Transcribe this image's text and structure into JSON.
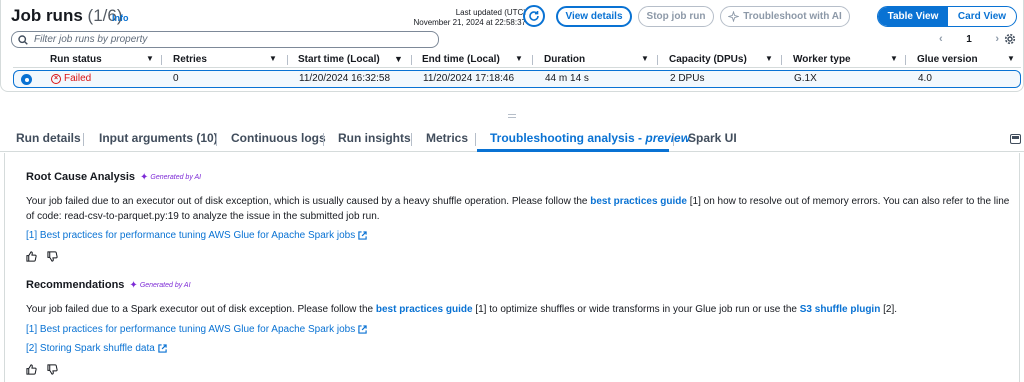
{
  "header": {
    "title": "Job runs",
    "count": "(1/6)",
    "info": "Info",
    "last_updated_label": "Last updated (UTC)",
    "last_updated_value": "November 21, 2024 at 22:58:37",
    "view_details": "View details",
    "stop_job_run": "Stop job run",
    "troubleshoot_ai": "Troubleshoot with AI",
    "table_view": "Table View",
    "card_view": "Card View"
  },
  "search": {
    "placeholder": "Filter job runs by property"
  },
  "pagination": {
    "page": "1",
    "prev": "‹",
    "next": "›"
  },
  "table": {
    "columns": [
      "Run status",
      "Retries",
      "Start time (Local)",
      "End time (Local)",
      "Duration",
      "Capacity (DPUs)",
      "Worker type",
      "Glue version"
    ],
    "row": {
      "status": "Failed",
      "retries": "0",
      "start_time": "11/20/2024 16:32:58",
      "end_time": "11/20/2024 17:18:46",
      "duration": "44 m 14 s",
      "capacity": "2 DPUs",
      "worker_type": "G.1X",
      "glue_version": "4.0"
    }
  },
  "tabs": [
    "Run details",
    "Input arguments (10)",
    "Continuous logs",
    "Run insights",
    "Metrics",
    "Troubleshooting analysis - ",
    "Spark UI"
  ],
  "tab_preview": "preview",
  "rca": {
    "title": "Root Cause Analysis",
    "badge": "Generated by AI",
    "text_1": "Your job failed due to an executor out of disk exception, which is usually caused by a heavy shuffle operation. Please follow the ",
    "link_1": "best practices guide",
    "text_2": " [1] on how to resolve out of memory errors. You can also refer to the line of code: read-csv-to-parquet.py:19 to analyze the issue in the submitted job run.",
    "ref_1": "[1] Best practices for performance tuning AWS Glue for Apache Spark jobs"
  },
  "rec": {
    "title": "Recommendations",
    "badge": "Generated by AI",
    "text_1": "Your job failed due to a Spark executor out of disk exception. Please follow the ",
    "link_1": "best practices guide",
    "text_2": " [1] to optimize shuffles or wide transforms in your Glue job run or use the ",
    "link_2": "S3 shuffle plugin",
    "text_3": " [2].",
    "ref_1": "[1] Best practices for performance tuning AWS Glue for Apache Spark jobs",
    "ref_2": "[2] Storing Spark shuffle data"
  },
  "colors": {
    "accent": "#0972d3",
    "error": "#d91515",
    "ai": "#7d2bd6"
  }
}
